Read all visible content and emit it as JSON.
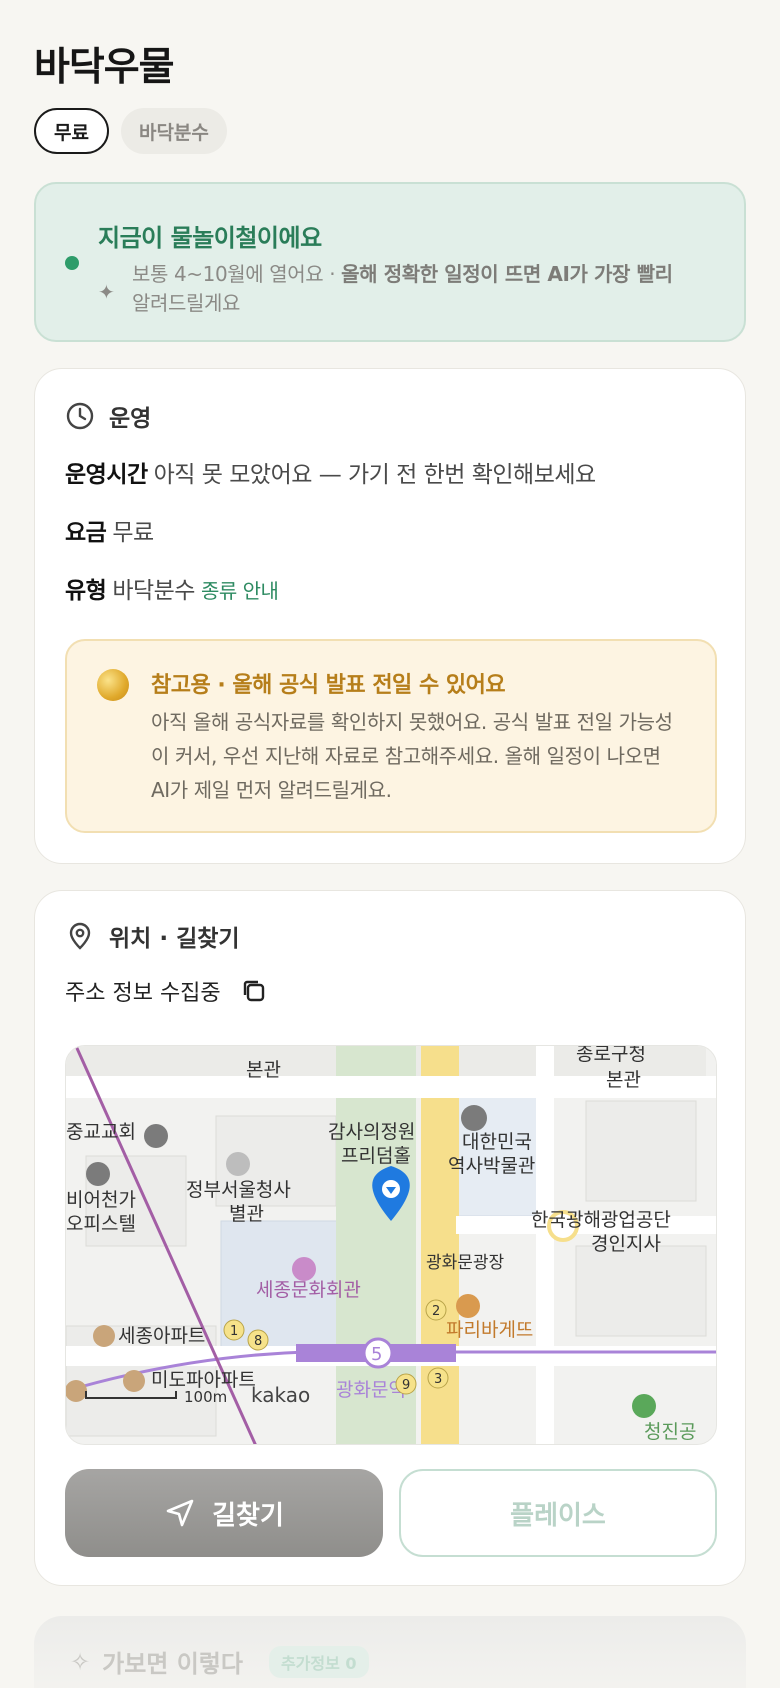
{
  "page": {
    "title": "바닥우물"
  },
  "chips": [
    {
      "label": "무료",
      "active": true
    },
    {
      "label": "바닥분수",
      "active": false
    }
  ],
  "season": {
    "headline": "지금이 물놀이철이에요",
    "detail_plain": "보통 4~10월에 열어요 · ",
    "detail_bold": "올해 정확한 일정이 뜨면 AI가 가장 빨리",
    "detail_tail": "알려드릴게요",
    "accent": "#2e9c6a"
  },
  "operation": {
    "section_title": "운영",
    "hours_key": "운영시간",
    "hours_value": "아직 못 모았어요 — 가기 전 한번 확인해보세요",
    "fee_key": "요금",
    "fee_value": "무료",
    "type_key": "유형",
    "type_value": "바닥분수",
    "type_link": "종류 안내",
    "notice": {
      "title": "참고용 · 올해 공식 발표 전일 수 있어요",
      "body": "아직 올해 공식자료를 확인하지 못했어요. 공식 발표 전일 가능성이 커서, 우선 지난해 자료로 참고해주세요. 올해 일정이 나오면 AI가 제일 먼저 알려드릴게요."
    }
  },
  "location": {
    "section_title": "위치 · 길찾기",
    "address": "주소 정보 수집중",
    "map": {
      "labels": {
        "hall_top": "본관",
        "hall_top2": "종로구청",
        "hall_top2b": "본관",
        "church": "중교교회",
        "audit": "감사의정원",
        "audit2": "프리덤홀",
        "museum": "대한민국",
        "museum2": "역사박물관",
        "gov": "정부서울청사",
        "gov2": "별관",
        "office": "비어천가",
        "office2": "오피스텔",
        "kmp": "한국광해광업공단",
        "kmp2": "경인지사",
        "square": "광화문광장",
        "sejong": "세종문화회관",
        "paris": "파리바게뜨",
        "apt1": "세종아파트",
        "apt2": "미도파아파트",
        "station": "광화문역",
        "scale": "100m",
        "brand": "kakao",
        "park": "청진공",
        "line_no": "5",
        "exit1": "1",
        "exit8": "8",
        "exit2": "2",
        "exit9": "9",
        "exit3": "3"
      }
    },
    "nav_button": "길찾기",
    "place_button": "플레이스"
  },
  "next_section": {
    "title": "가보면 이렇다",
    "badge": "추가정보 0"
  }
}
